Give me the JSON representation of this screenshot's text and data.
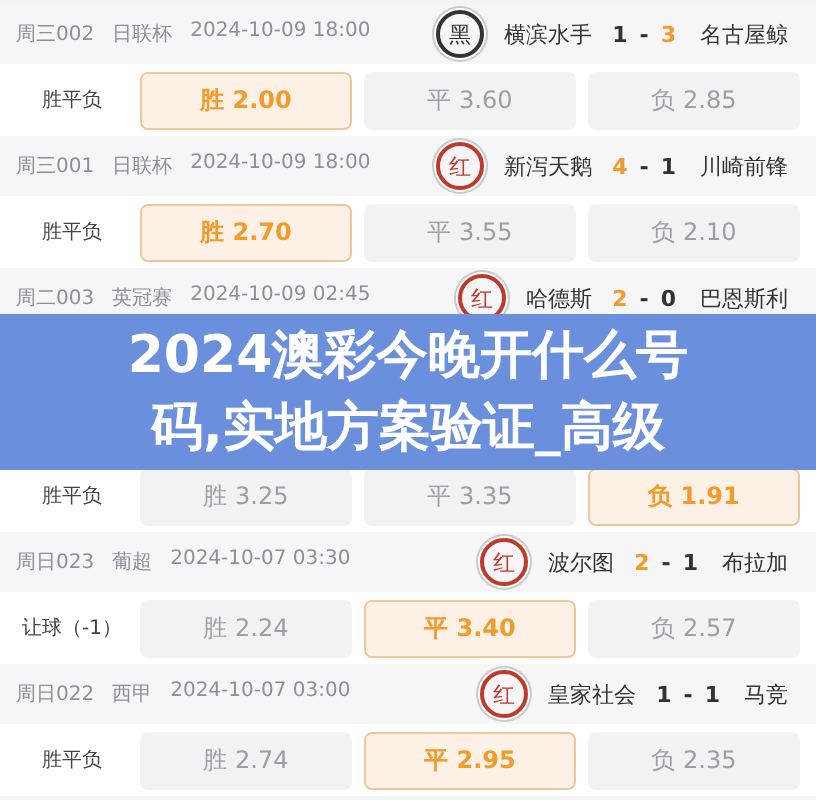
{
  "matches": [
    {
      "header": {
        "code": "周三002",
        "league": "日联杯",
        "time": "2024-10-09 18:00",
        "stamp": {
          "text": "黑",
          "color": "#333333"
        },
        "home": "横滨水手",
        "home_score": {
          "text": "1",
          "won": false
        },
        "separator": "-",
        "away_score": {
          "text": "3",
          "won": true
        },
        "away": "名古屋鲸"
      },
      "odds": {
        "market": "胜平负",
        "options": [
          {
            "label": "胜 2.00",
            "selected": true
          },
          {
            "label": "平 3.60",
            "selected": false
          },
          {
            "label": "负 2.85",
            "selected": false
          }
        ]
      }
    },
    {
      "header": {
        "code": "周三001",
        "league": "日联杯",
        "time": "2024-10-09 18:00",
        "stamp": {
          "text": "红",
          "color": "#c0392b"
        },
        "home": "新泻天鹅",
        "home_score": {
          "text": "4",
          "won": true
        },
        "separator": "-",
        "away_score": {
          "text": "1",
          "won": false
        },
        "away": "川崎前锋"
      },
      "odds": {
        "market": "胜平负",
        "options": [
          {
            "label": "胜 2.70",
            "selected": true
          },
          {
            "label": "平 3.55",
            "selected": false
          },
          {
            "label": "负 2.10",
            "selected": false
          }
        ]
      }
    },
    {
      "header": {
        "code": "周二003",
        "league": "英冠赛",
        "time": "2024-10-09 02:45",
        "stamp": {
          "text": "红",
          "color": "#c0392b"
        },
        "home": "哈德斯",
        "home_score": {
          "text": "2",
          "won": true
        },
        "separator": "-",
        "away_score": {
          "text": "0",
          "won": false
        },
        "away": "巴恩斯利"
      }
    },
    {
      "odds": {
        "market": "胜平负",
        "options": [
          {
            "label": "胜 3.25",
            "selected": false
          },
          {
            "label": "平 3.35",
            "selected": false
          },
          {
            "label": "负 1.91",
            "selected": true
          }
        ]
      }
    },
    {
      "header": {
        "code": "周日023",
        "league": "葡超",
        "time": "2024-10-07 03:30",
        "stamp": {
          "text": "红",
          "color": "#c0392b"
        },
        "home": "波尔图",
        "home_score": {
          "text": "2",
          "won": true
        },
        "separator": "-",
        "away_score": {
          "text": "1",
          "won": false
        },
        "away": "布拉加"
      },
      "odds": {
        "market": "让球（-1）",
        "options": [
          {
            "label": "胜 2.24",
            "selected": false
          },
          {
            "label": "平 3.40",
            "selected": true
          },
          {
            "label": "负 2.57",
            "selected": false
          }
        ]
      }
    },
    {
      "header": {
        "code": "周日022",
        "league": "西甲",
        "time": "2024-10-07 03:00",
        "stamp": {
          "text": "红",
          "color": "#c0392b"
        },
        "home": "皇家社会",
        "home_score": {
          "text": "1",
          "won": false
        },
        "separator": "-",
        "away_score": {
          "text": "1",
          "won": false
        },
        "away": "马竞"
      },
      "odds": {
        "market": "胜平负",
        "options": [
          {
            "label": "胜 2.74",
            "selected": false
          },
          {
            "label": "平 2.95",
            "selected": true
          },
          {
            "label": "负 2.35",
            "selected": false
          }
        ]
      }
    }
  ],
  "banner": {
    "title": "2024澳彩今晚开什么号码,实地方案验证_高级"
  }
}
